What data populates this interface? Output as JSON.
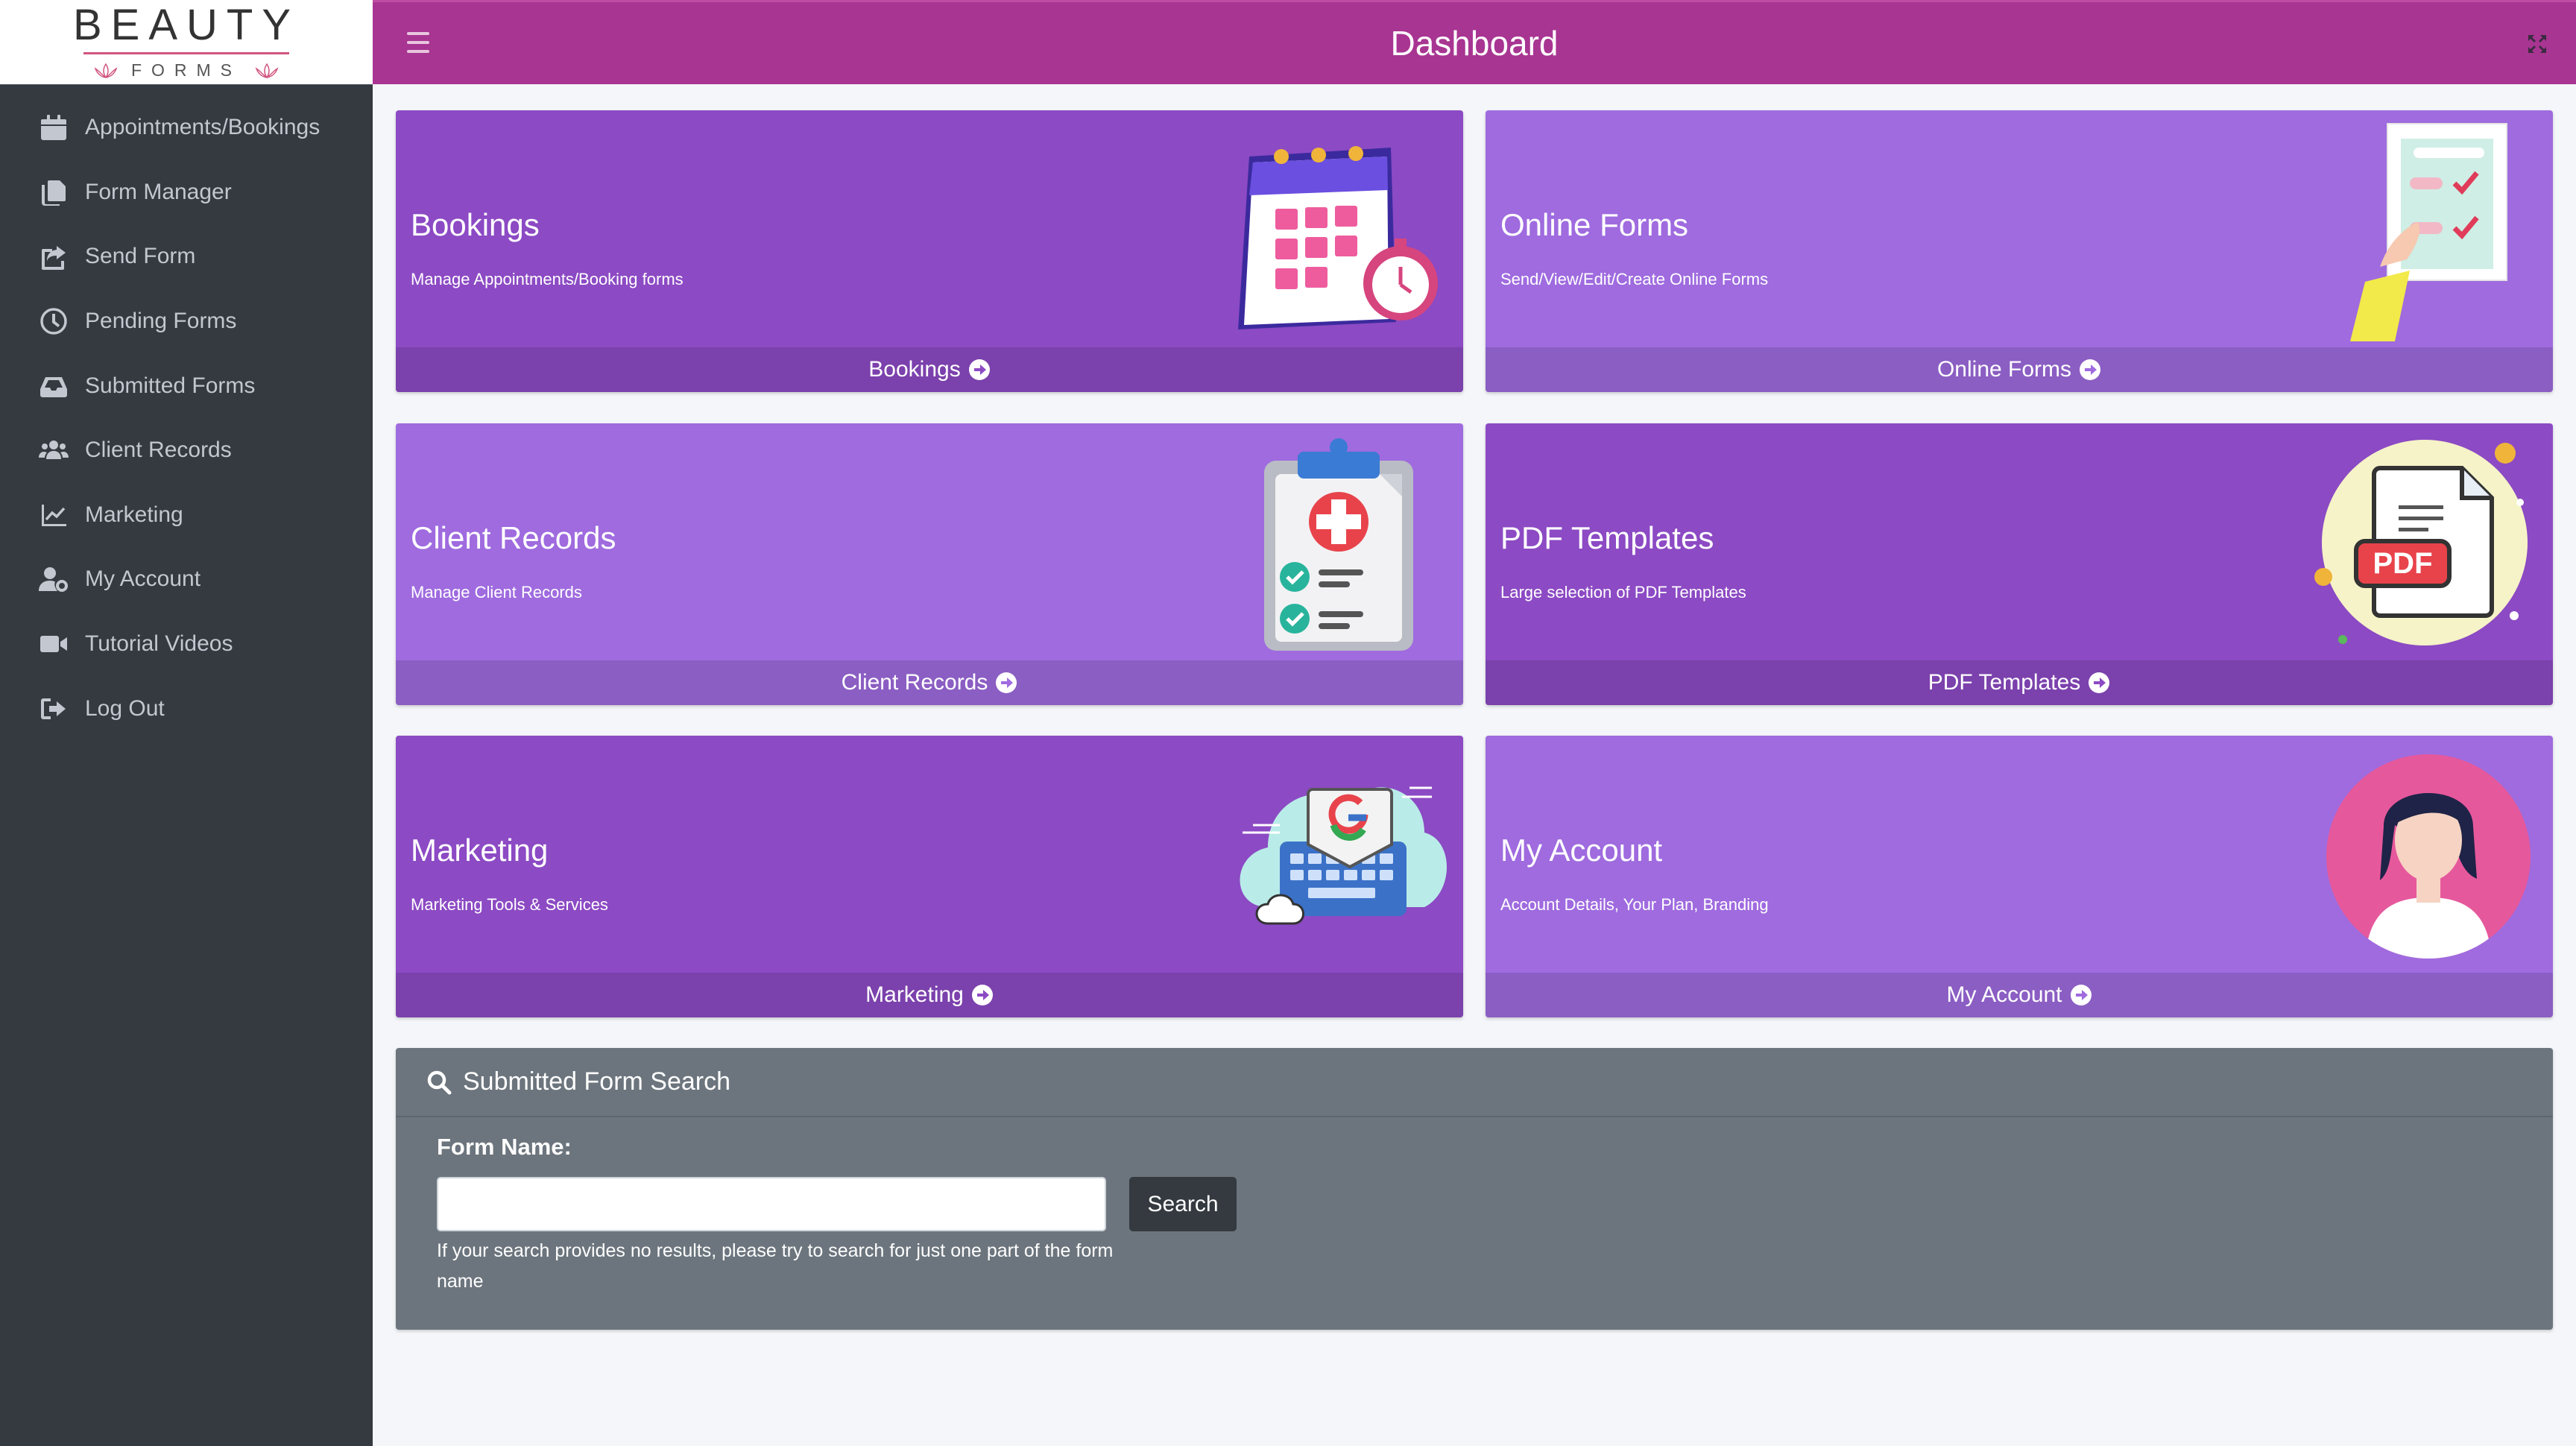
{
  "logo": {
    "main": "BEAUTY",
    "sub": "FORMS"
  },
  "sidebar": {
    "items": [
      {
        "label": "Appointments/Bookings",
        "icon": "calendar-icon"
      },
      {
        "label": "Form Manager",
        "icon": "copy-icon"
      },
      {
        "label": "Send Form",
        "icon": "share-square-icon"
      },
      {
        "label": "Pending Forms",
        "icon": "clock-icon"
      },
      {
        "label": "Submitted Forms",
        "icon": "inbox-icon"
      },
      {
        "label": "Client Records",
        "icon": "users-icon"
      },
      {
        "label": "Marketing",
        "icon": "chart-line-icon"
      },
      {
        "label": "My Account",
        "icon": "user-cog-icon"
      },
      {
        "label": "Tutorial Videos",
        "icon": "video-icon"
      },
      {
        "label": "Log Out",
        "icon": "sign-out-icon"
      }
    ]
  },
  "header": {
    "title": "Dashboard"
  },
  "cards": [
    {
      "title": "Bookings",
      "subtitle": "Manage Appointments/Booking forms",
      "link": "Bookings"
    },
    {
      "title": "Online Forms",
      "subtitle": "Send/View/Edit/Create Online Forms",
      "link": "Online Forms"
    },
    {
      "title": "Client Records",
      "subtitle": "Manage Client Records",
      "link": "Client Records"
    },
    {
      "title": "PDF Templates",
      "subtitle": "Large selection of PDF Templates",
      "link": "PDF Templates"
    },
    {
      "title": "Marketing",
      "subtitle": "Marketing Tools & Services",
      "link": "Marketing"
    },
    {
      "title": "My Account",
      "subtitle": "Account Details, Your Plan, Branding",
      "link": "My Account"
    }
  ],
  "search": {
    "title": "Submitted Form Search",
    "label": "Form Name:",
    "value": "",
    "button": "Search",
    "hint": "If your search provides no results, please try to search for just one part of the form name"
  },
  "pdf_badge": "PDF",
  "colors": {
    "header": "#a83592",
    "sidebar": "#343a40",
    "card_dark": "#8c4ac4",
    "card_light": "#9f6bdf",
    "search_panel": "#6c757d"
  }
}
